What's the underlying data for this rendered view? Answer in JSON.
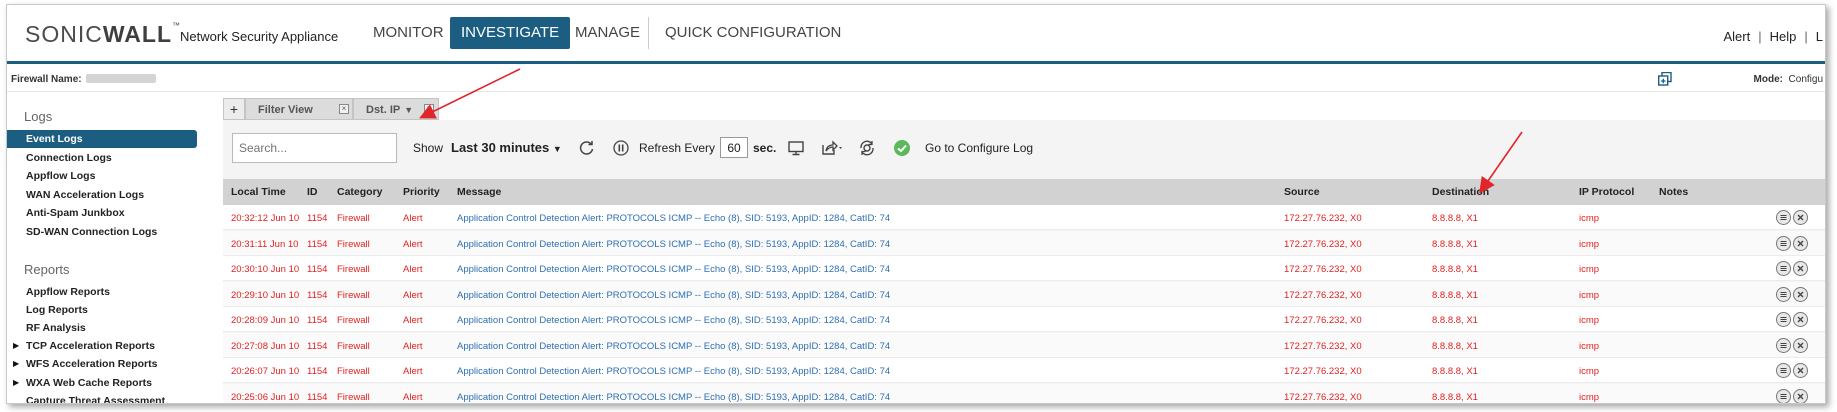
{
  "brand": {
    "logo_light": "SONIC",
    "logo_bold": "WALL",
    "logo_mark": "™",
    "product": "Network Security Appliance"
  },
  "nav": {
    "tabs": [
      {
        "label": "MONITOR"
      },
      {
        "label": "INVESTIGATE",
        "active": true
      },
      {
        "label": "MANAGE"
      },
      {
        "label": "QUICK CONFIGURATION"
      }
    ],
    "links": [
      "Alert",
      "Help",
      "L"
    ]
  },
  "firewall": {
    "label": "Firewall Name:",
    "mode_label": "Mode:",
    "mode_value": "Configu"
  },
  "sidebar": {
    "logs_heading": "Logs",
    "logs": [
      "Event Logs",
      "Connection Logs",
      "Appflow Logs",
      "WAN Acceleration Logs",
      "Anti-Spam Junkbox",
      "SD-WAN Connection Logs"
    ],
    "reports_heading": "Reports",
    "reports": [
      "Appflow Reports",
      "Log Reports",
      "RF Analysis",
      "TCP Acceleration Reports",
      "WFS Acceleration Reports",
      "WXA Web Cache Reports",
      "Capture Threat Assessment"
    ]
  },
  "filterbar": {
    "plus": "+",
    "chips": [
      "Filter View",
      "Dst. IP"
    ]
  },
  "toolbar": {
    "search_placeholder": "Search...",
    "show_label": "Show",
    "time_range": "Last 30 minutes",
    "refresh_label": "Refresh Every",
    "refresh_value": "60",
    "refresh_unit": "sec.",
    "configure_link": "Go to Configure Log"
  },
  "table": {
    "columns": [
      "Local Time",
      "ID",
      "Category",
      "Priority",
      "Message",
      "Source",
      "Destination",
      "IP Protocol",
      "Notes"
    ],
    "rows": [
      {
        "time": "20:32:12 Jun 10",
        "id": "1154",
        "category": "Firewall",
        "priority": "Alert",
        "message": "Application Control Detection Alert: PROTOCOLS ICMP -- Echo (8), SID: 5193, AppID: 1284, CatID: 74",
        "source": "172.27.76.232, X0",
        "destination": "8.8.8.8, X1",
        "protocol": "icmp"
      },
      {
        "time": "20:31:11 Jun 10",
        "id": "1154",
        "category": "Firewall",
        "priority": "Alert",
        "message": "Application Control Detection Alert: PROTOCOLS ICMP -- Echo (8), SID: 5193, AppID: 1284, CatID: 74",
        "source": "172.27.76.232, X0",
        "destination": "8.8.8.8, X1",
        "protocol": "icmp"
      },
      {
        "time": "20:30:10 Jun 10",
        "id": "1154",
        "category": "Firewall",
        "priority": "Alert",
        "message": "Application Control Detection Alert: PROTOCOLS ICMP -- Echo (8), SID: 5193, AppID: 1284, CatID: 74",
        "source": "172.27.76.232, X0",
        "destination": "8.8.8.8, X1",
        "protocol": "icmp"
      },
      {
        "time": "20:29:10 Jun 10",
        "id": "1154",
        "category": "Firewall",
        "priority": "Alert",
        "message": "Application Control Detection Alert: PROTOCOLS ICMP -- Echo (8), SID: 5193, AppID: 1284, CatID: 74",
        "source": "172.27.76.232, X0",
        "destination": "8.8.8.8, X1",
        "protocol": "icmp"
      },
      {
        "time": "20:28:09 Jun 10",
        "id": "1154",
        "category": "Firewall",
        "priority": "Alert",
        "message": "Application Control Detection Alert: PROTOCOLS ICMP -- Echo (8), SID: 5193, AppID: 1284, CatID: 74",
        "source": "172.27.76.232, X0",
        "destination": "8.8.8.8, X1",
        "protocol": "icmp"
      },
      {
        "time": "20:27:08 Jun 10",
        "id": "1154",
        "category": "Firewall",
        "priority": "Alert",
        "message": "Application Control Detection Alert: PROTOCOLS ICMP -- Echo (8), SID: 5193, AppID: 1284, CatID: 74",
        "source": "172.27.76.232, X0",
        "destination": "8.8.8.8, X1",
        "protocol": "icmp"
      },
      {
        "time": "20:26:07 Jun 10",
        "id": "1154",
        "category": "Firewall",
        "priority": "Alert",
        "message": "Application Control Detection Alert: PROTOCOLS ICMP -- Echo (8), SID: 5193, AppID: 1284, CatID: 74",
        "source": "172.27.76.232, X0",
        "destination": "8.8.8.8, X1",
        "protocol": "icmp"
      },
      {
        "time": "20:25:06 Jun 10",
        "id": "1154",
        "category": "Firewall",
        "priority": "Alert",
        "message": "Application Control Detection Alert: PROTOCOLS ICMP -- Echo (8), SID: 5193, AppID: 1284, CatID: 74",
        "source": "172.27.76.232, X0",
        "destination": "8.8.8.8, X1",
        "protocol": "icmp"
      }
    ]
  },
  "colors": {
    "accent": "#1c5d82",
    "alert_red": "#e32020",
    "message_blue": "#2e6fb2",
    "annotation_arrow": "#e0262b"
  }
}
